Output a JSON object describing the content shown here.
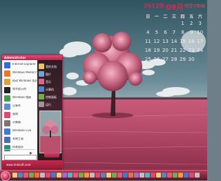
{
  "calendar": {
    "year_label": "2011年",
    "month_label": "09月",
    "caption": "隨雪宇數碼",
    "weekdays": [
      "日",
      "一",
      "二",
      "三",
      "四",
      "五",
      "六"
    ],
    "days": [
      "",
      "",
      "",
      "",
      "1",
      "2",
      "3",
      "4",
      "5",
      "6",
      "7",
      "8",
      "9",
      "10",
      "11",
      "12",
      "13",
      "14",
      "15",
      "16",
      "17",
      "18",
      "19",
      "20",
      "21",
      "22",
      "23",
      "24",
      "25",
      "26",
      "27",
      "28",
      "29",
      "30",
      ""
    ]
  },
  "start_menu": {
    "user_name": "Administrator",
    "left_items": [
      {
        "label": "Internet Explorer",
        "icon": "ie-icon",
        "color": "#2f6fd6"
      },
      {
        "label": "Windows Media Player",
        "icon": "media-player-icon",
        "color": "#e8762d"
      },
      {
        "label": "启动 Windows 资源管理器",
        "icon": "explorer-icon",
        "color": "#d9a43a"
      },
      {
        "label": "命令提示符",
        "icon": "cmd-icon",
        "color": "#222222"
      },
      {
        "label": "Windows 相册",
        "icon": "photo-icon",
        "color": "#3f9c4a"
      },
      {
        "label": "记事本",
        "icon": "notepad-icon",
        "color": "#5a8fd0"
      },
      {
        "label": "画图",
        "icon": "paint-icon",
        "color": "#d84c71"
      },
      {
        "label": "计算器",
        "icon": "calculator-icon",
        "color": "#777777"
      },
      {
        "label": "Windows Live",
        "icon": "live-icon",
        "color": "#3a7bd5"
      },
      {
        "label": "系统工具",
        "icon": "tools-icon",
        "color": "#4b6fa8"
      },
      {
        "label": "所有程序",
        "icon": "programs-icon",
        "color": "#2f8f7a"
      }
    ],
    "right_items": [
      {
        "label": "我的文档",
        "icon": "documents-icon",
        "color": "#e7c56a"
      },
      {
        "label": "图片",
        "icon": "pictures-icon",
        "color": "#6fa5d8"
      },
      {
        "label": "音乐",
        "icon": "music-icon",
        "color": "#d56a8a"
      },
      {
        "label": "计算机",
        "icon": "computer-icon",
        "color": "#4f86c6"
      },
      {
        "label": "控制面板",
        "icon": "control-panel-icon",
        "color": "#6ab04c"
      },
      {
        "label": "运行",
        "icon": "run-icon",
        "color": "#999999"
      }
    ],
    "all_programs_arrow": "▶",
    "footer_text": "www.lmdsoft.com"
  },
  "taskbar": {
    "start_label": "Start",
    "tray_text": "",
    "icon_colors": [
      "#f2d06b",
      "#4f86c6",
      "#e05a7b",
      "#6ab04c",
      "#e8762d",
      "#bfbfbf",
      "#d84c71",
      "#3a7bd5",
      "#f2d06b",
      "#9c6fd6",
      "#4fb6c6",
      "#e05a7b",
      "#6ab04c",
      "#f29b3a",
      "#bfbfbf",
      "#d84c71",
      "#4f86c6",
      "#f2d06b",
      "#6ab04c",
      "#e05a7b",
      "#3a7bd5",
      "#e8762d",
      "#9c6fd6",
      "#bfbfbf",
      "#4fb6c6",
      "#d84c71",
      "#f2d06b",
      "#4f86c6",
      "#e05a7b",
      "#6ab04c",
      "#f29b3a",
      "#3a7bd5",
      "#d84c71",
      "#bfbfbf"
    ]
  }
}
